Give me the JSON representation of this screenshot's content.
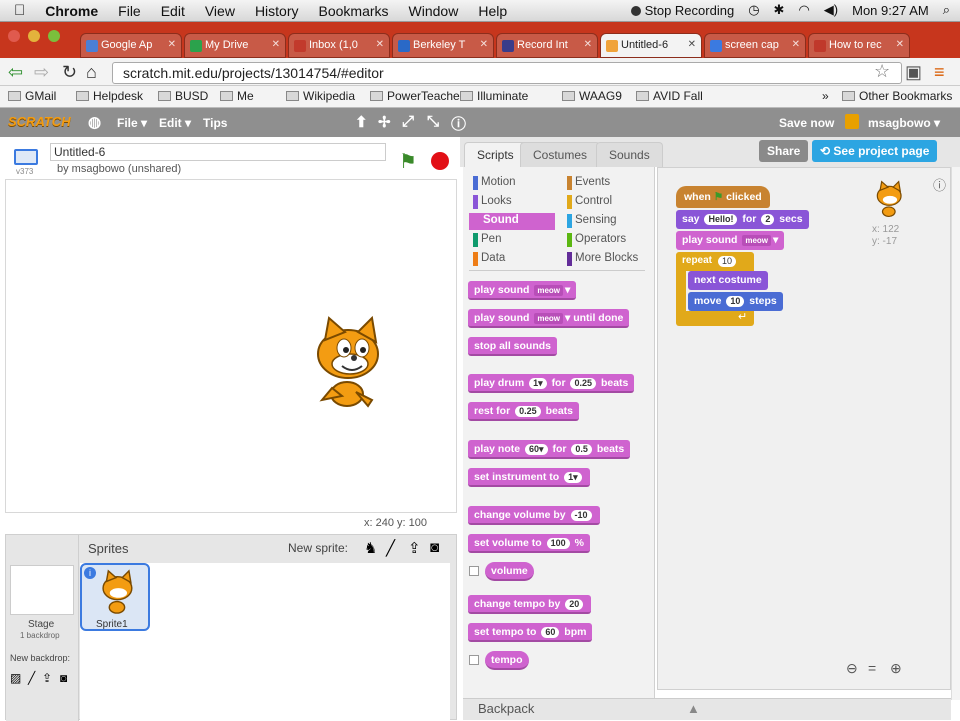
{
  "mac_menubar": {
    "app": "Chrome",
    "items": [
      "File",
      "Edit",
      "View",
      "History",
      "Bookmarks",
      "Window",
      "Help"
    ],
    "recording": "Stop Recording",
    "clock": "Mon 9:27 AM"
  },
  "browser_tabs": [
    {
      "label": "Google Ap",
      "color": "#4a7fd6"
    },
    {
      "label": "My Drive",
      "color": "#2ba24c"
    },
    {
      "label": "Inbox (1,0",
      "color": "#c23a2c"
    },
    {
      "label": "Berkeley T",
      "color": "#2a69c7"
    },
    {
      "label": "Record Int",
      "color": "#3a3c8a"
    },
    {
      "label": "Untitled-6",
      "color": "#f0a33a"
    },
    {
      "label": "screen cap",
      "color": "#3b7ae0"
    },
    {
      "label": "How to rec",
      "color": "#c0392b"
    }
  ],
  "address_bar": {
    "url": "scratch.mit.edu/projects/13014754/#editor"
  },
  "bookmarks": [
    "GMail",
    "Helpdesk",
    "BUSD",
    "Me",
    "Wikipedia",
    "PowerTeacher",
    "Illuminate",
    "WAAG9",
    "AVID Fall"
  ],
  "other_bookmarks": "Other Bookmarks",
  "scratch_menu": {
    "logo": "SCRATCH",
    "file": "File",
    "edit": "Edit",
    "tips": "Tips",
    "save_now": "Save now",
    "user": "msagbowo"
  },
  "stage_header": {
    "version": "v373",
    "title": "Untitled-6",
    "byline": "by msagbowo (unshared)"
  },
  "stage": {
    "coords": "x: 240  y: 100"
  },
  "sprite_pane": {
    "stage_label": "Stage",
    "backdrop_count": "1 backdrop",
    "new_backdrop": "New backdrop:",
    "sprites_title": "Sprites",
    "new_sprite": "New sprite:",
    "sprite_name": "Sprite1"
  },
  "editor_tabs": [
    "Scripts",
    "Costumes",
    "Sounds"
  ],
  "editor_buttons": {
    "share": "Share",
    "see_project": "See project page"
  },
  "categories": [
    {
      "name": "Motion",
      "color": "#4a6cd4"
    },
    {
      "name": "Events",
      "color": "#c88330"
    },
    {
      "name": "Looks",
      "color": "#8a55d7"
    },
    {
      "name": "Control",
      "color": "#e1a91a"
    },
    {
      "name": "Sound",
      "color": "#cf63cf",
      "active": true
    },
    {
      "name": "Sensing",
      "color": "#2ca5e2"
    },
    {
      "name": "Pen",
      "color": "#0e9a6c"
    },
    {
      "name": "Operators",
      "color": "#5cb712"
    },
    {
      "name": "Data",
      "color": "#ee7d16"
    },
    {
      "name": "More Blocks",
      "color": "#632d99"
    }
  ],
  "palette_blocks": [
    {
      "parts": [
        "play sound",
        {
          "dd": "meow"
        }
      ]
    },
    {
      "parts": [
        "play sound",
        {
          "dd": "meow"
        },
        "until done"
      ]
    },
    {
      "parts": [
        "stop all sounds"
      ]
    },
    {
      "parts": [
        "play drum",
        {
          "rep": "1▾"
        },
        "for",
        {
          "rep": "0.25"
        },
        "beats"
      ]
    },
    {
      "parts": [
        "rest for",
        {
          "rep": "0.25"
        },
        "beats"
      ]
    },
    {
      "parts": [
        "play note",
        {
          "rep": "60▾"
        },
        "for",
        {
          "rep": "0.5"
        },
        "beats"
      ]
    },
    {
      "parts": [
        "set instrument to",
        {
          "rep": "1▾"
        }
      ]
    },
    {
      "parts": [
        "change volume by",
        {
          "rep": "-10"
        }
      ]
    },
    {
      "parts": [
        "set volume to",
        {
          "rep": "100"
        },
        "%"
      ]
    },
    {
      "parts": [
        "volume"
      ],
      "reporter": true
    },
    {
      "parts": [
        "change tempo by",
        {
          "rep": "20"
        }
      ]
    },
    {
      "parts": [
        "set tempo to",
        {
          "rep": "60"
        },
        "bpm"
      ]
    },
    {
      "parts": [
        "tempo"
      ],
      "reporter": true
    }
  ],
  "script": {
    "hat": "when",
    "hat_end": "clicked",
    "say": "say",
    "say_msg": "Hello!",
    "say_for": "for",
    "say_secs": "2",
    "say_end": "secs",
    "play": "play sound",
    "play_dd": "meow",
    "repeat": "repeat",
    "repeat_n": "10",
    "next": "next costume",
    "move": "move",
    "move_n": "10",
    "move_end": "steps"
  },
  "sprite_info": {
    "x": "x: 122",
    "y": "y: -17"
  },
  "backpack": "Backpack"
}
